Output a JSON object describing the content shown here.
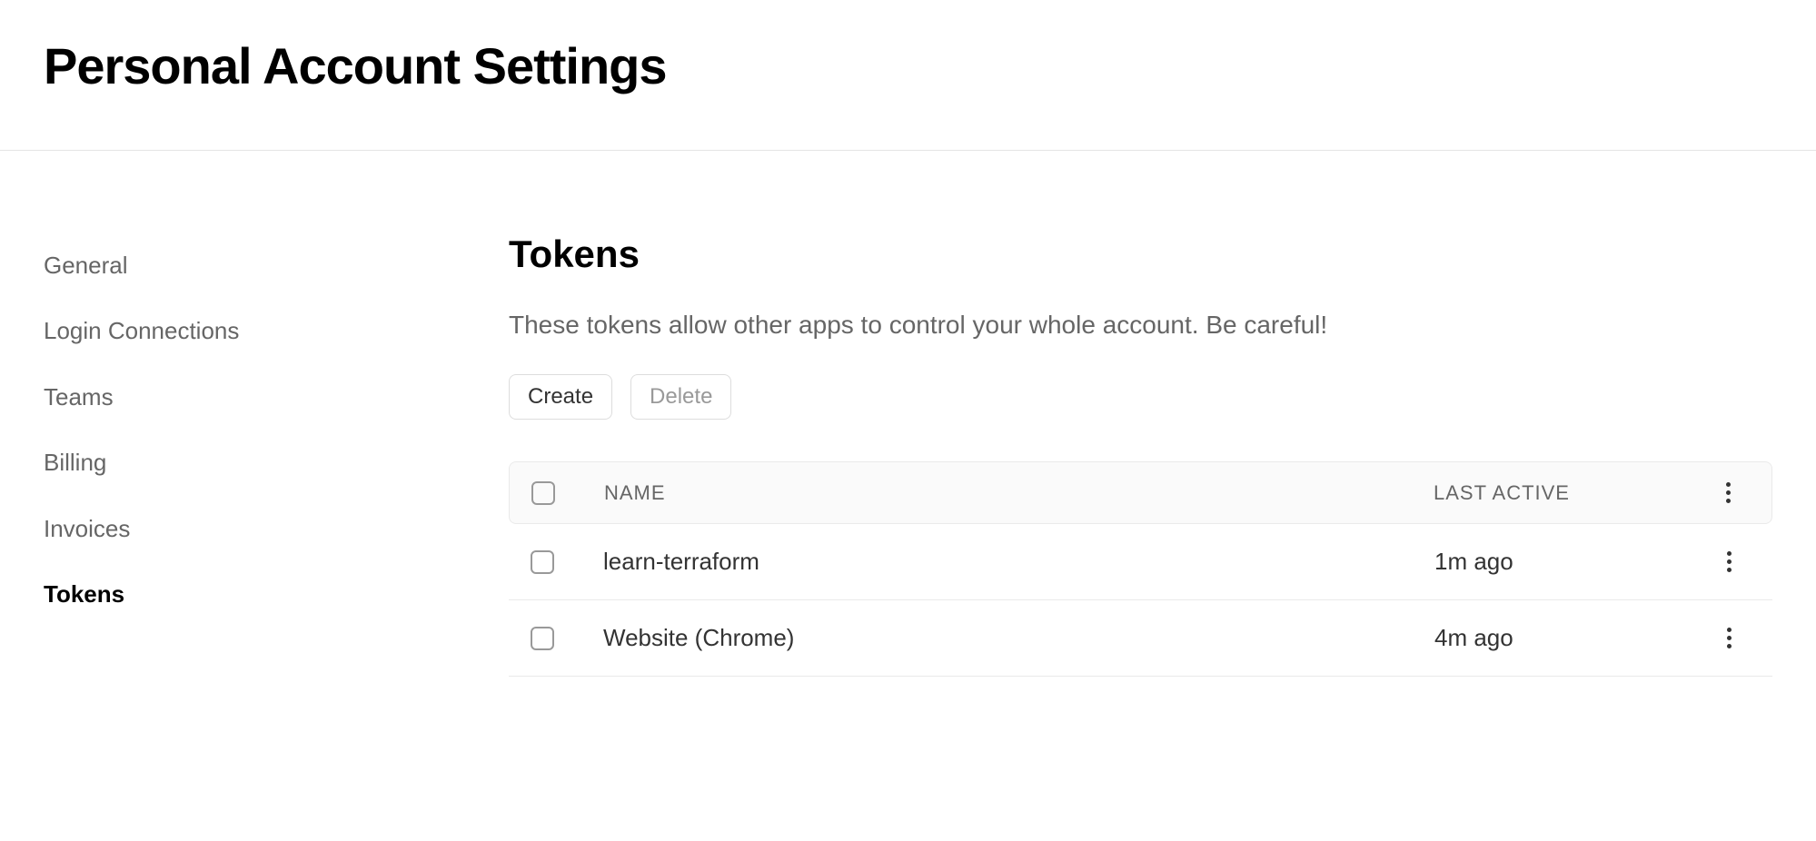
{
  "header": {
    "title": "Personal Account Settings"
  },
  "sidebar": {
    "items": [
      {
        "label": "General",
        "active": false
      },
      {
        "label": "Login Connections",
        "active": false
      },
      {
        "label": "Teams",
        "active": false
      },
      {
        "label": "Billing",
        "active": false
      },
      {
        "label": "Invoices",
        "active": false
      },
      {
        "label": "Tokens",
        "active": true
      }
    ]
  },
  "main": {
    "title": "Tokens",
    "description": "These tokens allow other apps to control your whole account. Be careful!",
    "create_label": "Create",
    "delete_label": "Delete",
    "table": {
      "columns": {
        "name": "NAME",
        "last_active": "LAST ACTIVE"
      },
      "rows": [
        {
          "name": "learn-terraform",
          "last_active": "1m ago"
        },
        {
          "name": "Website (Chrome)",
          "last_active": "4m ago"
        }
      ]
    }
  }
}
